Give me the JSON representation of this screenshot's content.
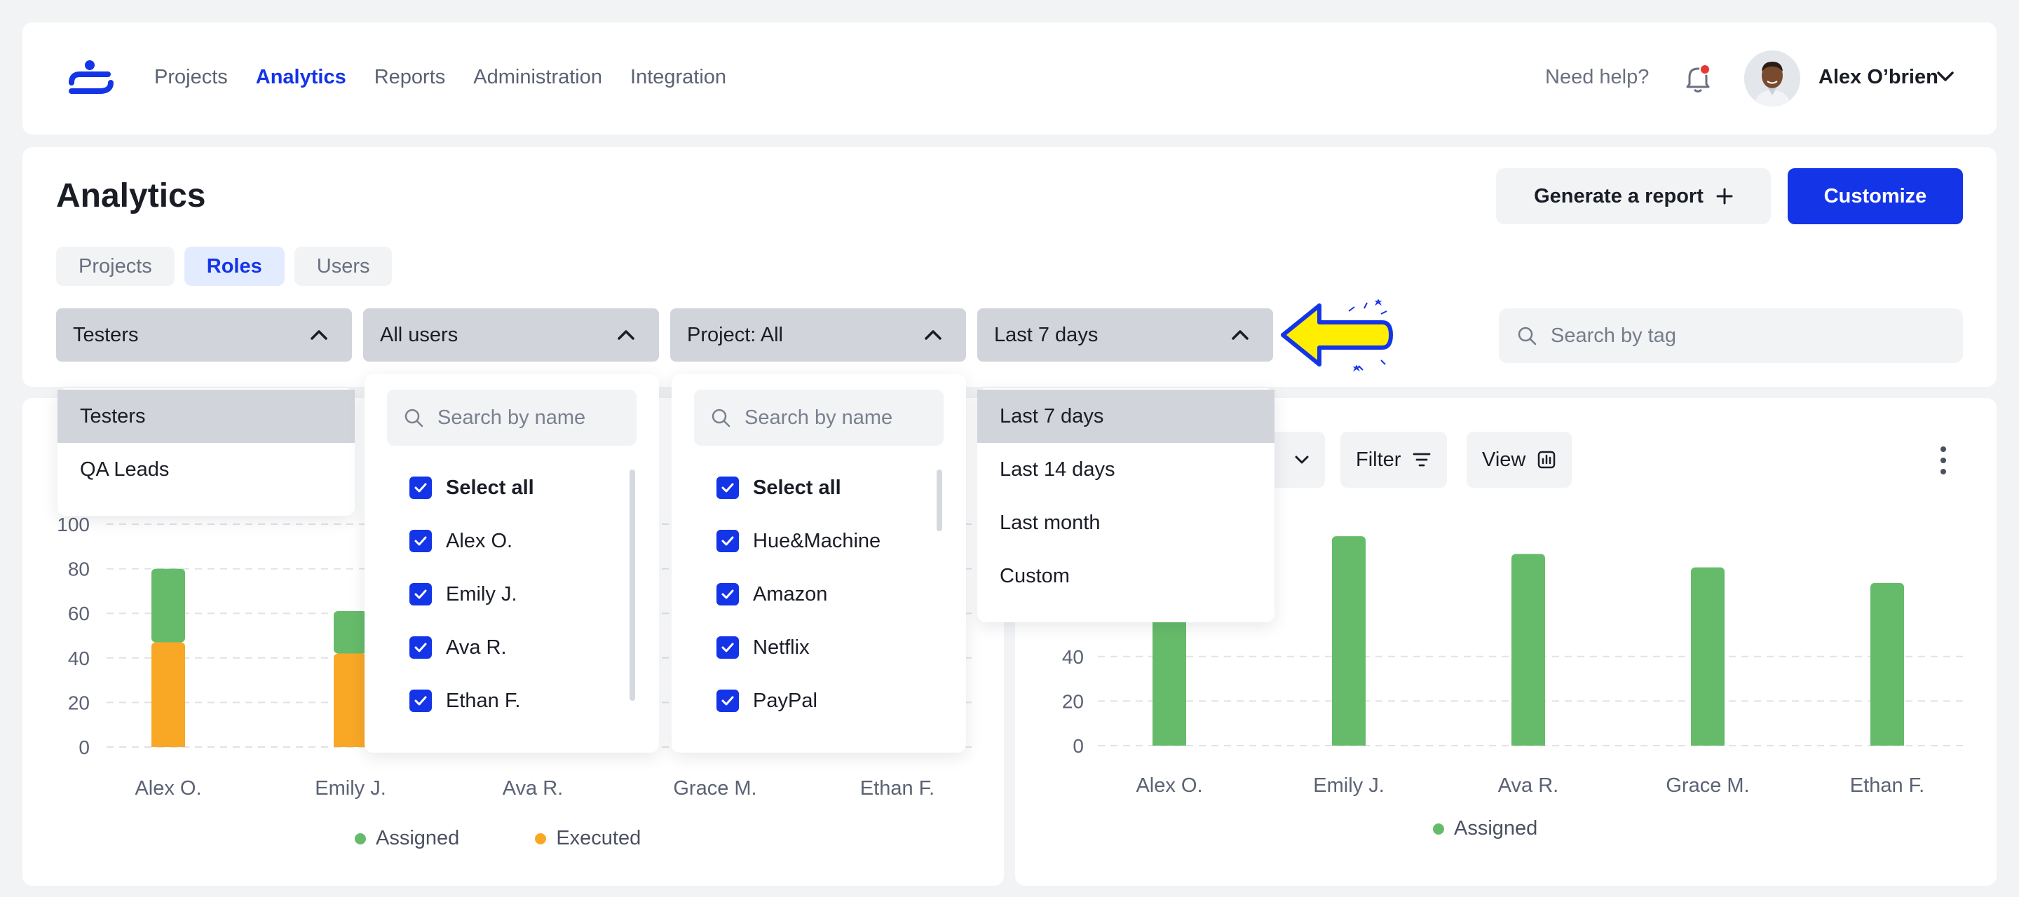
{
  "nav": {
    "items": [
      "Projects",
      "Analytics",
      "Reports",
      "Administration",
      "Integration"
    ],
    "active": "Analytics"
  },
  "header": {
    "help": "Need help?",
    "user_name": "Alex O’brien"
  },
  "page": {
    "title": "Analytics",
    "generate_label": "Generate a report",
    "customize_label": "Customize"
  },
  "tabs": [
    "Projects",
    "Roles",
    "Users"
  ],
  "filters": {
    "role": "Testers",
    "users": "All users",
    "project": "Project: All",
    "period": "Last 7 days",
    "search_tag_placeholder": "Search by tag"
  },
  "role_menu": [
    "Testers",
    "QA Leads"
  ],
  "users_menu": {
    "search_placeholder": "Search by name",
    "items": [
      "Select all",
      "Alex O.",
      "Emily J.",
      "Ava R.",
      "Ethan F."
    ]
  },
  "projects_menu": {
    "search_placeholder": "Search by name",
    "items": [
      "Select all",
      "Hue&Machine",
      "Amazon",
      "Netflix",
      "PayPal"
    ]
  },
  "period_menu": [
    "Last 7 days",
    "Last 14 days",
    "Last month",
    "Custom"
  ],
  "right_toolbar": {
    "filter_label": "Filter",
    "view_label": "View"
  },
  "colors": {
    "accent": "#1434e8",
    "assigned": "#66bb6a",
    "executed": "#f9a825",
    "notification": "#e53935"
  },
  "chart_data": [
    {
      "type": "bar",
      "stacked": true,
      "categories": [
        "Alex O.",
        "Emily J.",
        "Ava R.",
        "Grace M.",
        "Ethan F."
      ],
      "series": [
        {
          "name": "Executed",
          "values": [
            47,
            42,
            null,
            null,
            null
          ]
        },
        {
          "name": "Assigned",
          "values": [
            33,
            19,
            null,
            null,
            null
          ]
        }
      ],
      "yticks": [
        0,
        20,
        40,
        60,
        80,
        100
      ],
      "ylim": [
        0,
        100
      ],
      "legend": [
        "Assigned",
        "Executed"
      ],
      "legend_position": "bottom-center"
    },
    {
      "type": "bar",
      "categories": [
        "Alex O.",
        "Emily J.",
        "Ava R.",
        "Grace M.",
        "Ethan F."
      ],
      "series": [
        {
          "name": "Assigned",
          "values": [
            58,
            94,
            86,
            80,
            73
          ]
        }
      ],
      "yticks": [
        0,
        20,
        40
      ],
      "ylim": [
        0,
        100
      ],
      "legend": [
        "Assigned"
      ],
      "legend_position": "bottom-center"
    }
  ]
}
